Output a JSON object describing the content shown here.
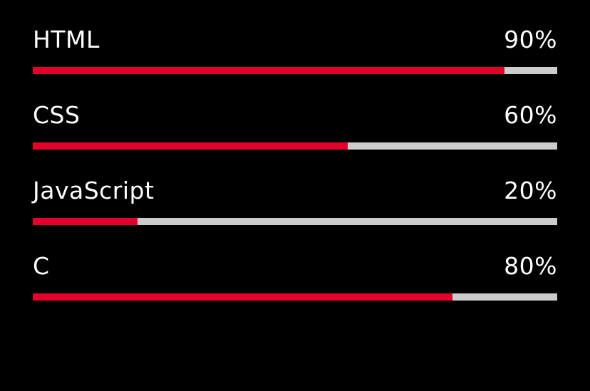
{
  "colors": {
    "background": "#000000",
    "text": "#ffffff",
    "fill": "#e4002b",
    "track": "#cccccc"
  },
  "skills": [
    {
      "name": "HTML",
      "percent_label": "90%",
      "value": 0.9
    },
    {
      "name": "CSS",
      "percent_label": "60%",
      "value": 0.6
    },
    {
      "name": "JavaScript",
      "percent_label": "20%",
      "value": 0.2
    },
    {
      "name": "C",
      "percent_label": "80%",
      "value": 0.8
    }
  ]
}
